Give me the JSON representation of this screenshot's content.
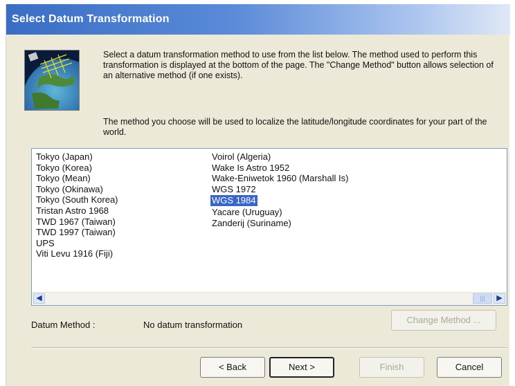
{
  "dialog": {
    "title": "Select Datum Transformation",
    "intro": "Select a datum transformation method to use from the list below. The method used to perform this transformation is displayed at the bottom of the page. The \"Change Method\" button allows selection of an alternative method (if one exists).",
    "intro2": "The method you choose will be used to localize the latitude/longitude coordinates for your part of the world."
  },
  "datum_list": {
    "column1": [
      "Tokyo (Japan)",
      "Tokyo (Korea)",
      "Tokyo (Mean)",
      "Tokyo (Okinawa)",
      "Tokyo (South Korea)",
      "Tristan Astro 1968",
      "TWD 1967 (Taiwan)",
      "TWD 1997 (Taiwan)",
      "UPS",
      "Viti Levu 1916 (Fiji)"
    ],
    "column2": [
      "Voirol (Algeria)",
      "Wake Is Astro 1952",
      "Wake-Eniwetok 1960 (Marshall Is)",
      "WGS 1972",
      "WGS 1984",
      "Yacare (Uruguay)",
      "Zanderij (Suriname)"
    ],
    "selected": "WGS 1984"
  },
  "method": {
    "label": "Datum Method :",
    "value": "No datum transformation",
    "change_button": "Change Method ..."
  },
  "buttons": {
    "back": "< Back",
    "next": "Next >",
    "finish": "Finish",
    "cancel": "Cancel"
  },
  "colors": {
    "title_bar": "#3a6ec5",
    "selection": "#3a66c9",
    "dialog_bg": "#ece9d8"
  }
}
